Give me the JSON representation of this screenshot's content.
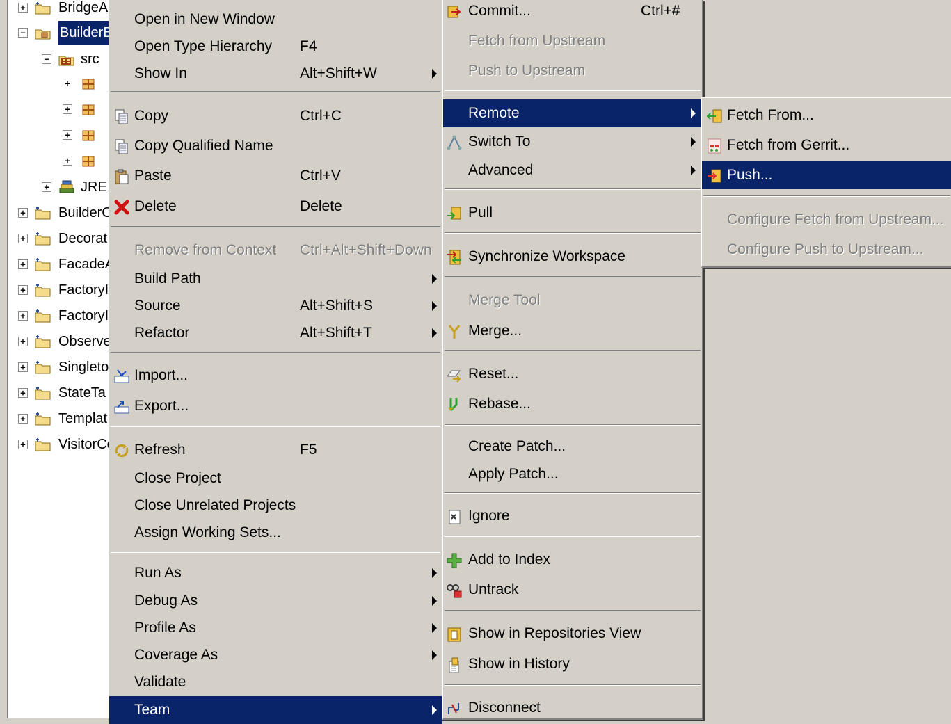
{
  "tree": {
    "items": [
      {
        "label": "BridgeAı",
        "toggle": "+"
      },
      {
        "label": "BuilderB",
        "toggle": "−",
        "selected": true
      },
      {
        "label": "src",
        "toggle": "−"
      },
      {
        "label": "JRE",
        "toggle": "+"
      },
      {
        "label": "BuilderC",
        "toggle": "+"
      },
      {
        "label": "Decorat",
        "toggle": "+"
      },
      {
        "label": "FacadeA",
        "toggle": "+"
      },
      {
        "label": "FactoryI",
        "toggle": "+"
      },
      {
        "label": "FactoryI",
        "toggle": "+"
      },
      {
        "label": "Observe",
        "toggle": "+"
      },
      {
        "label": "Singletor",
        "toggle": "+"
      },
      {
        "label": "StateTa",
        "toggle": "+"
      },
      {
        "label": "Templat",
        "toggle": "+"
      },
      {
        "label": "VisitorCo",
        "toggle": "+"
      }
    ]
  },
  "context_menu": {
    "items": [
      {
        "label": "Open in New Window"
      },
      {
        "label": "Open Type Hierarchy",
        "shortcut": "F4"
      },
      {
        "label": "Show In",
        "shortcut": "Alt+Shift+W",
        "submenu": true
      },
      {
        "label": "Copy",
        "shortcut": "Ctrl+C",
        "icon": "copy-icon"
      },
      {
        "label": "Copy Qualified Name",
        "icon": "copy-qualified-name-icon"
      },
      {
        "label": "Paste",
        "shortcut": "Ctrl+V",
        "icon": "paste-icon"
      },
      {
        "label": "Delete",
        "shortcut": "Delete",
        "icon": "delete-icon"
      },
      {
        "label": "Remove from Context",
        "shortcut": "Ctrl+Alt+Shift+Down",
        "disabled": true
      },
      {
        "label": "Build Path",
        "submenu": true
      },
      {
        "label": "Source",
        "shortcut": "Alt+Shift+S",
        "submenu": true
      },
      {
        "label": "Refactor",
        "shortcut": "Alt+Shift+T",
        "submenu": true
      },
      {
        "label": "Import...",
        "icon": "import-icon"
      },
      {
        "label": "Export...",
        "icon": "export-icon"
      },
      {
        "label": "Refresh",
        "shortcut": "F5",
        "icon": "refresh-icon"
      },
      {
        "label": "Close Project"
      },
      {
        "label": "Close Unrelated Projects"
      },
      {
        "label": "Assign Working Sets..."
      },
      {
        "label": "Run As",
        "submenu": true
      },
      {
        "label": "Debug As",
        "submenu": true
      },
      {
        "label": "Profile As",
        "submenu": true
      },
      {
        "label": "Coverage As",
        "submenu": true
      },
      {
        "label": "Validate"
      },
      {
        "label": "Team",
        "submenu": true,
        "highlighted": true
      }
    ]
  },
  "team_menu": {
    "items": [
      {
        "label": "Commit...",
        "shortcut": "Ctrl+#",
        "icon": "commit-icon"
      },
      {
        "label": "Fetch from Upstream",
        "disabled": true
      },
      {
        "label": "Push to Upstream",
        "disabled": true
      },
      {
        "label": "Remote",
        "submenu": true,
        "highlighted": true
      },
      {
        "label": "Switch To",
        "submenu": true,
        "icon": "switch-to-icon"
      },
      {
        "label": "Advanced",
        "submenu": true
      },
      {
        "label": "Pull",
        "icon": "pull-icon"
      },
      {
        "label": "Synchronize Workspace",
        "icon": "synchronize-icon"
      },
      {
        "label": "Merge Tool",
        "disabled": true
      },
      {
        "label": "Merge...",
        "icon": "merge-icon"
      },
      {
        "label": "Reset...",
        "icon": "reset-icon"
      },
      {
        "label": "Rebase...",
        "icon": "rebase-icon"
      },
      {
        "label": "Create Patch..."
      },
      {
        "label": "Apply Patch..."
      },
      {
        "label": "Ignore",
        "icon": "ignore-icon"
      },
      {
        "label": "Add to Index",
        "icon": "add-to-index-icon"
      },
      {
        "label": "Untrack",
        "icon": "untrack-icon"
      },
      {
        "label": "Show in Repositories View",
        "icon": "repositories-view-icon"
      },
      {
        "label": "Show in History",
        "icon": "history-icon"
      },
      {
        "label": "Disconnect",
        "icon": "disconnect-icon"
      }
    ]
  },
  "remote_menu": {
    "items": [
      {
        "label": "Fetch From...",
        "icon": "fetch-from-icon"
      },
      {
        "label": "Fetch from Gerrit...",
        "icon": "fetch-gerrit-icon"
      },
      {
        "label": "Push...",
        "icon": "push-icon",
        "highlighted": true
      },
      {
        "label": "Configure Fetch from Upstream...",
        "disabled": true
      },
      {
        "label": "Configure Push to Upstream...",
        "disabled": true
      }
    ]
  },
  "colors": {
    "menu_background": "#d4d0c8",
    "highlight": "#0a246a",
    "disabled_text": "#808080"
  }
}
